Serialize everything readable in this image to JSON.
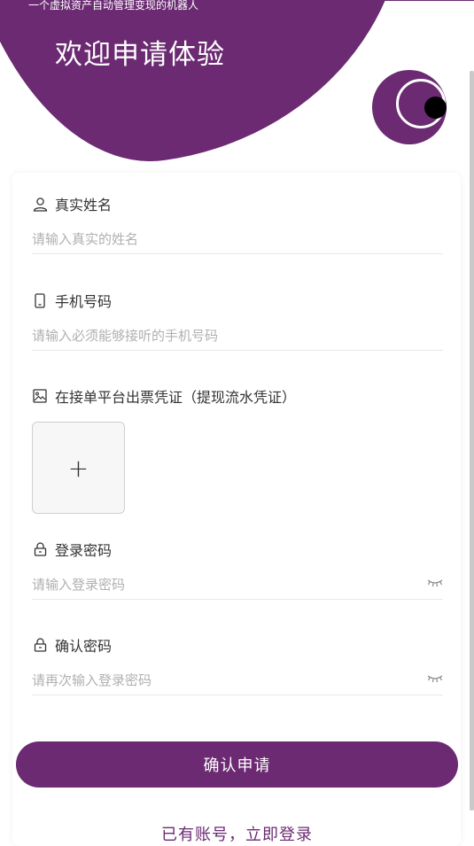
{
  "header": {
    "tagline": "一个虚拟资产自动管理变现的机器人",
    "title": "欢迎申请体验"
  },
  "colors": {
    "primary": "#6b2a72",
    "placeholder": "#b0b0b0",
    "divider": "#e8e8e8"
  },
  "form": {
    "name": {
      "label": "真实姓名",
      "placeholder": "请输入真实的姓名",
      "icon": "user-icon"
    },
    "phone": {
      "label": "手机号码",
      "placeholder": "请输入必须能够接听的手机号码",
      "icon": "phone-icon"
    },
    "voucher": {
      "label": "在接单平台出票凭证（提现流水凭证）",
      "icon": "image-icon",
      "upload_symbol": "+"
    },
    "password": {
      "label": "登录密码",
      "placeholder": "请输入登录密码",
      "icon": "lock-icon"
    },
    "confirm": {
      "label": "确认密码",
      "placeholder": "请再次输入登录密码",
      "icon": "lock-icon"
    }
  },
  "actions": {
    "submit_label": "确认申请",
    "login_link": "已有账号，立即登录"
  }
}
